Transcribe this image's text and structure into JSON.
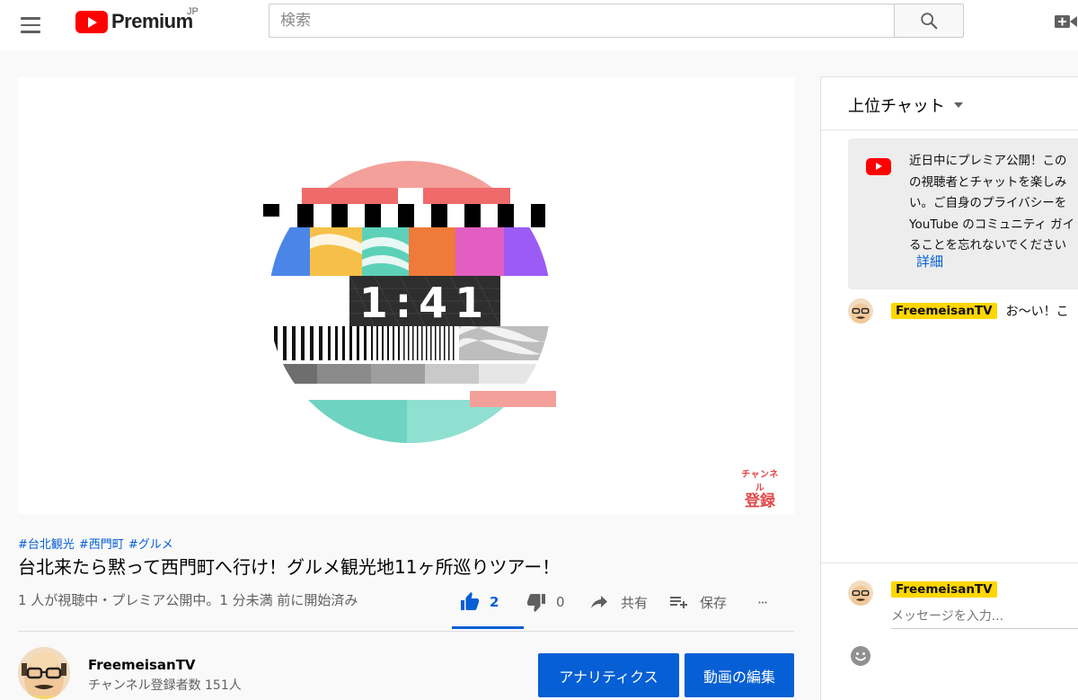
{
  "header": {
    "logo_text": "Premium",
    "region": "JP",
    "search_placeholder": "検索"
  },
  "player": {
    "countdown": "1:41",
    "watermark_small": "チャンネル",
    "watermark_big": "登録"
  },
  "video": {
    "hashtags": [
      "#台北観光",
      "#西門町",
      "#グルメ"
    ],
    "title": "台北来たら黙って西門町へ行け！グルメ観光地11ヶ所巡りツアー！",
    "view_info": "1 人が視聴中・プレミア公開中。1 分未満 前に開始済み",
    "likes": "2",
    "dislikes": "0",
    "share_label": "共有",
    "save_label": "保存"
  },
  "channel": {
    "name": "FreemeisanTV",
    "subscribers": "チャンネル登録者数 151人",
    "analytics_label": "アナリティクス",
    "edit_label": "動画の編集"
  },
  "chat": {
    "mode_label": "上位チャット",
    "notice_lines": [
      "近日中にプレミア公開！この",
      "の視聴者とチャットを楽しみ",
      "い。ご自身のプライバシーを",
      "YouTube のコミュニティ ガイ",
      "ることを忘れないでください"
    ],
    "notice_link": "詳細",
    "message": {
      "author": "FreemeisanTV",
      "text": "お〜い！こ"
    },
    "composer": {
      "author": "FreemeisanTV",
      "placeholder": "メッセージを入力..."
    }
  },
  "colors": {
    "accent": "#065fd4",
    "brand": "#ff0000",
    "author_badge": "#ffd600"
  }
}
